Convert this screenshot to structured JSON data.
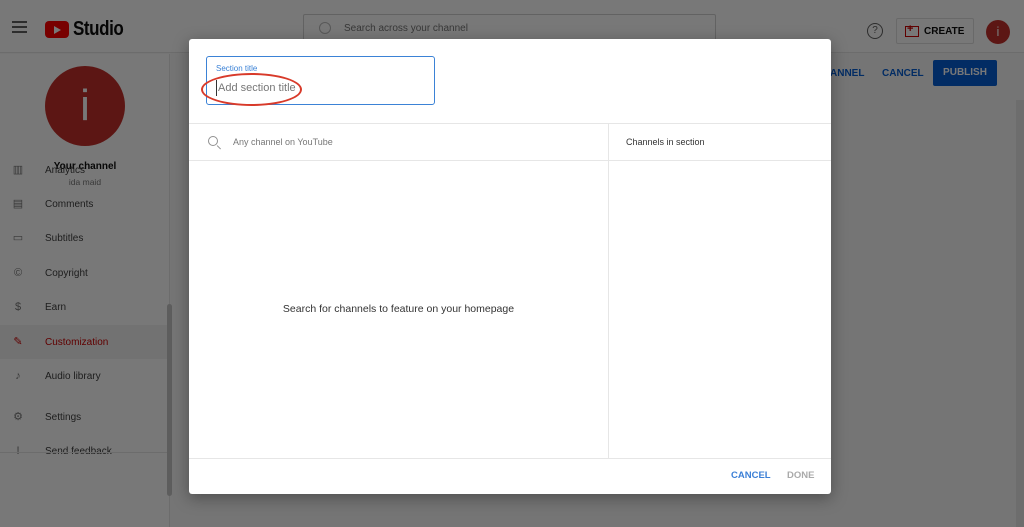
{
  "app": {
    "logo_text": "Studio",
    "search_placeholder": "Search across your channel",
    "help_icon": "?",
    "create_label": "CREATE",
    "account_initial": "i"
  },
  "sidebar": {
    "channel_initial": "i",
    "channel_title": "Your channel",
    "channel_name": "ida maid",
    "items": [
      {
        "label": "Analytics",
        "icon": "analytics-icon",
        "glyph": "▥",
        "active": false
      },
      {
        "label": "Comments",
        "icon": "comments-icon",
        "glyph": "▤",
        "active": false
      },
      {
        "label": "Subtitles",
        "icon": "subtitles-icon",
        "glyph": "▭",
        "active": false
      },
      {
        "label": "Copyright",
        "icon": "copyright-icon",
        "glyph": "©",
        "active": false
      },
      {
        "label": "Earn",
        "icon": "earn-icon",
        "glyph": "$",
        "active": false
      },
      {
        "label": "Customization",
        "icon": "magic-wand-icon",
        "glyph": "✎",
        "active": true
      },
      {
        "label": "Audio library",
        "icon": "audio-library-icon",
        "glyph": "♪",
        "active": false
      },
      {
        "label": "Settings",
        "icon": "settings-icon",
        "glyph": "⚙",
        "active": false
      },
      {
        "label": "Send feedback",
        "icon": "feedback-icon",
        "glyph": "!",
        "active": false
      }
    ]
  },
  "editor": {
    "view_channel_label": "ANNEL",
    "cancel_label": "CANCEL",
    "publish_label": "PUBLISH"
  },
  "dialog": {
    "section_title_label": "Section title",
    "section_title_value": "",
    "section_title_placeholder": "Add section title",
    "channel_search_value": "",
    "channel_search_placeholder": "Any channel on YouTube",
    "channels_in_section_header": "Channels in section",
    "empty_message": "Search for channels to feature on your homepage",
    "cancel_label": "CANCEL",
    "done_label": "DONE"
  },
  "colors": {
    "accent_blue": "#065fd4",
    "youtube_red": "#ff0000",
    "active_red": "#cc0000",
    "annotation_red": "#d83a2a"
  }
}
